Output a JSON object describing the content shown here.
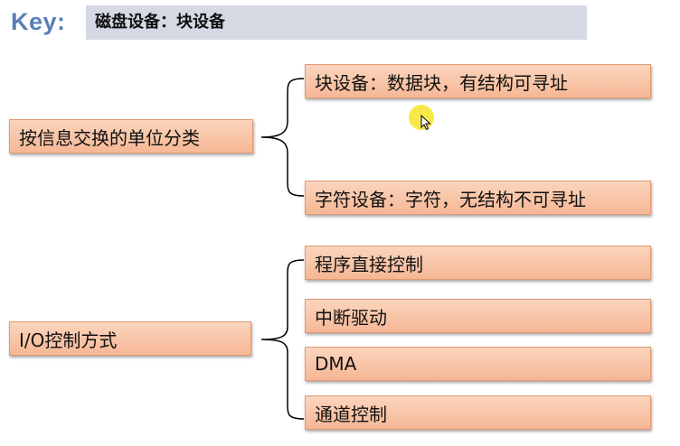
{
  "header": {
    "key_label": "Key:",
    "title": "磁盘设备：块设备"
  },
  "groups": [
    {
      "category": "按信息交换的单位分类",
      "items": [
        "块设备：数据块，有结构可寻址",
        "字符设备：字符，无结构不可寻址"
      ]
    },
    {
      "category": "I/O控制方式",
      "items": [
        "程序直接控制",
        "中断驱动",
        "DMA",
        "通道控制"
      ]
    }
  ],
  "colors": {
    "node_fill_top": "#fbd5bd",
    "node_fill_bottom": "#f6b795",
    "key_color": "#5a7fb8",
    "title_bar": "#d4d9e3"
  }
}
